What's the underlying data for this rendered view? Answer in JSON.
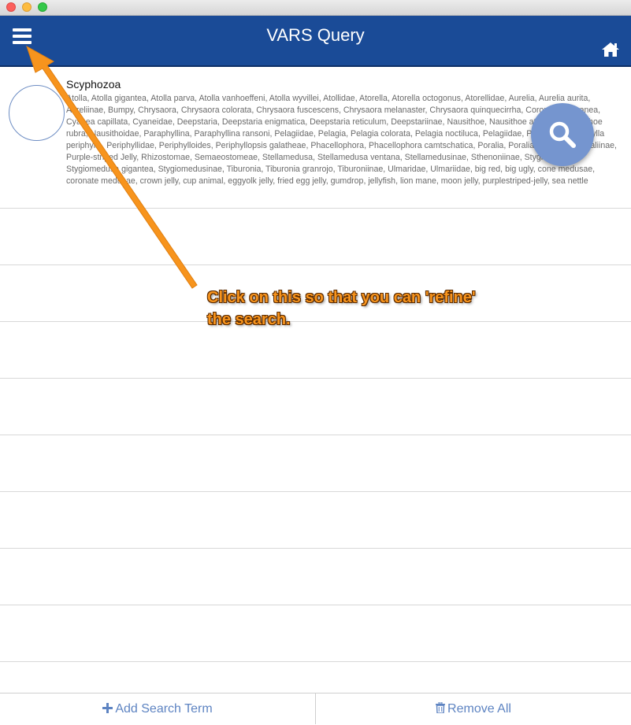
{
  "window": {
    "controls": [
      "close",
      "minimize",
      "maximize"
    ]
  },
  "header": {
    "title": "VARS Query",
    "menu_icon": "hamburger-menu-icon",
    "home_icon": "home-icon"
  },
  "results": [
    {
      "title": "Scyphozoa",
      "terms": "Atolla, Atolla gigantea, Atolla parva, Atolla vanhoeffeni, Atolla wyvillei, Atollidae, Atorella, Atorella octogonus, Atorellidae, Aurelia, Aurelia aurita, Aureliinae, Bumpy, Chrysaora, Chrysaora colorata, Chrysaora fuscescens, Chrysaora melanaster, Chrysaora quinquecirrha, Coronatae, Cyanea, Cyanea capillata, Cyaneidae, Deepstaria, Deepstaria enigmatica, Deepstaria reticulum, Deepstariinae, Nausithoe, Nausithoe atlantica, Nausithoe rubra, Nausithoidae, Paraphyllina, Paraphyllina ransoni, Pelagiidae, Pelagia, Pelagia colorata, Pelagia noctiluca, Pelagiidae, Periphylla, Periphylla periphylla, Periphyllidae, Periphylloides, Periphyllopsis galatheae, Phacellophora, Phacellophora camtschatica, Poralia, Poralia rufescens, Poraliinae, Purple-striped Jelly, Rhizostomae, Semaeostomeae, Stellamedusa, Stellamedusa ventana, Stellamedusinae, Sthenoniinae, Stygiomedusa, Stygiomedusa gigantea, Stygiomedusinae, Tiburonia, Tiburonia granrojo, Tiburoniinae, Ulmaridae, Ulmariidae, big red, big ugly, cone medusae, coronate medusae, crown jelly, cup animal, eggyolk jelly, fried egg jelly, gumdrop, jellyfish, lion mane, moon jelly, purplestriped-jelly, sea nettle"
    }
  ],
  "fab": {
    "icon": "search-icon"
  },
  "footer": {
    "add_label": "Add Search Term",
    "add_icon": "plus-icon",
    "remove_label": "Remove All",
    "remove_icon": "trash-icon"
  },
  "annotation": {
    "text": "Click on this so that you can 'refine' the search."
  },
  "colors": {
    "header_bg": "#1a4b97",
    "fab_bg": "#7595cf",
    "footer_text": "#5e84c2",
    "annotation": "#f7941d"
  }
}
